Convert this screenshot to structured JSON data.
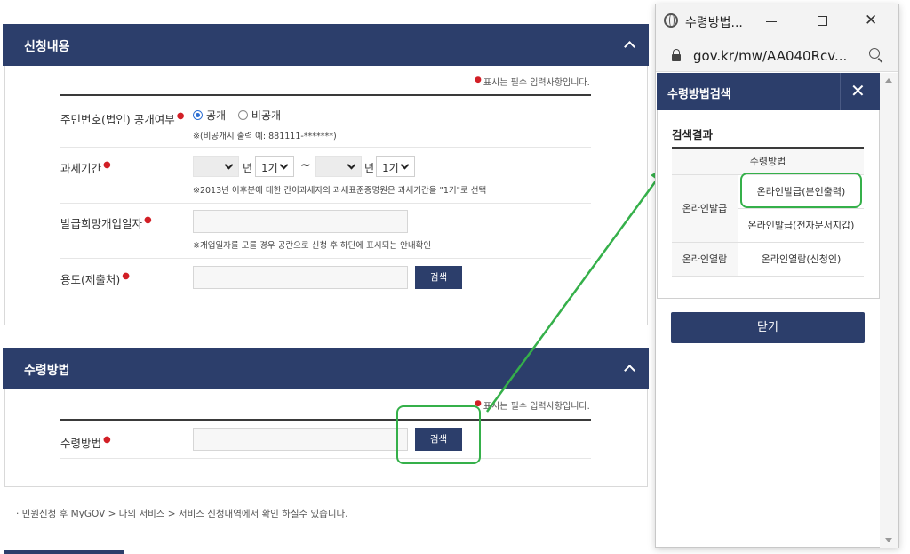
{
  "application_section": {
    "title": "신청내용",
    "required_note": "표시는 필수 입력사항입니다.",
    "fields": {
      "disclosure": {
        "label": "주민번호(법인) 공개여부",
        "option_public": "공개",
        "option_private": "비공개",
        "selected": "공개",
        "note": "※(비공개시 출력 예: 881111-*******)"
      },
      "tax_period": {
        "label": "과세기간",
        "year_suffix": "년",
        "start_period": "1기",
        "tilde": "~",
        "end_period": "1기",
        "note": "※2013년 이후분에 대한 간이과세자의 과세표준증명원은 과세기간을 \"1기\"로 선택"
      },
      "opening_date": {
        "label": "발급희망개업일자",
        "note": "※개업일자를 모를 경우 공란으로 신청 후 하단에 표시되는 안내확인"
      },
      "purpose": {
        "label": "용도(제출처)",
        "search_button": "검색"
      }
    }
  },
  "receipt_section": {
    "title": "수령방법",
    "required_note": "표시는 필수 입력사항입니다.",
    "method": {
      "label": "수령방법",
      "search_button": "검색"
    }
  },
  "footer_note": "· 민원신청 후 MyGOV > 나의 서비스 > 서비스 신청내역에서 확인 하실수 있습니다.",
  "popup": {
    "window_title": "수령방법...",
    "url": "gov.kr/mw/AA040Rcv...",
    "header": "수령방법검색",
    "result_title": "검색결과",
    "table": {
      "column_header": "수령방법",
      "rows": [
        {
          "group": "온라인발급",
          "option": "온라인발급(본인출력)"
        },
        {
          "group": "온라인발급",
          "option": "온라인발급(전자문서지갑)"
        },
        {
          "group": "온라인열람",
          "option": "온라인열람(신청인)"
        }
      ]
    },
    "close_button": "닫기"
  },
  "colors": {
    "header_navy": "#2c3e6b",
    "highlight_green": "#35b04a",
    "required_red": "#d21f26"
  }
}
